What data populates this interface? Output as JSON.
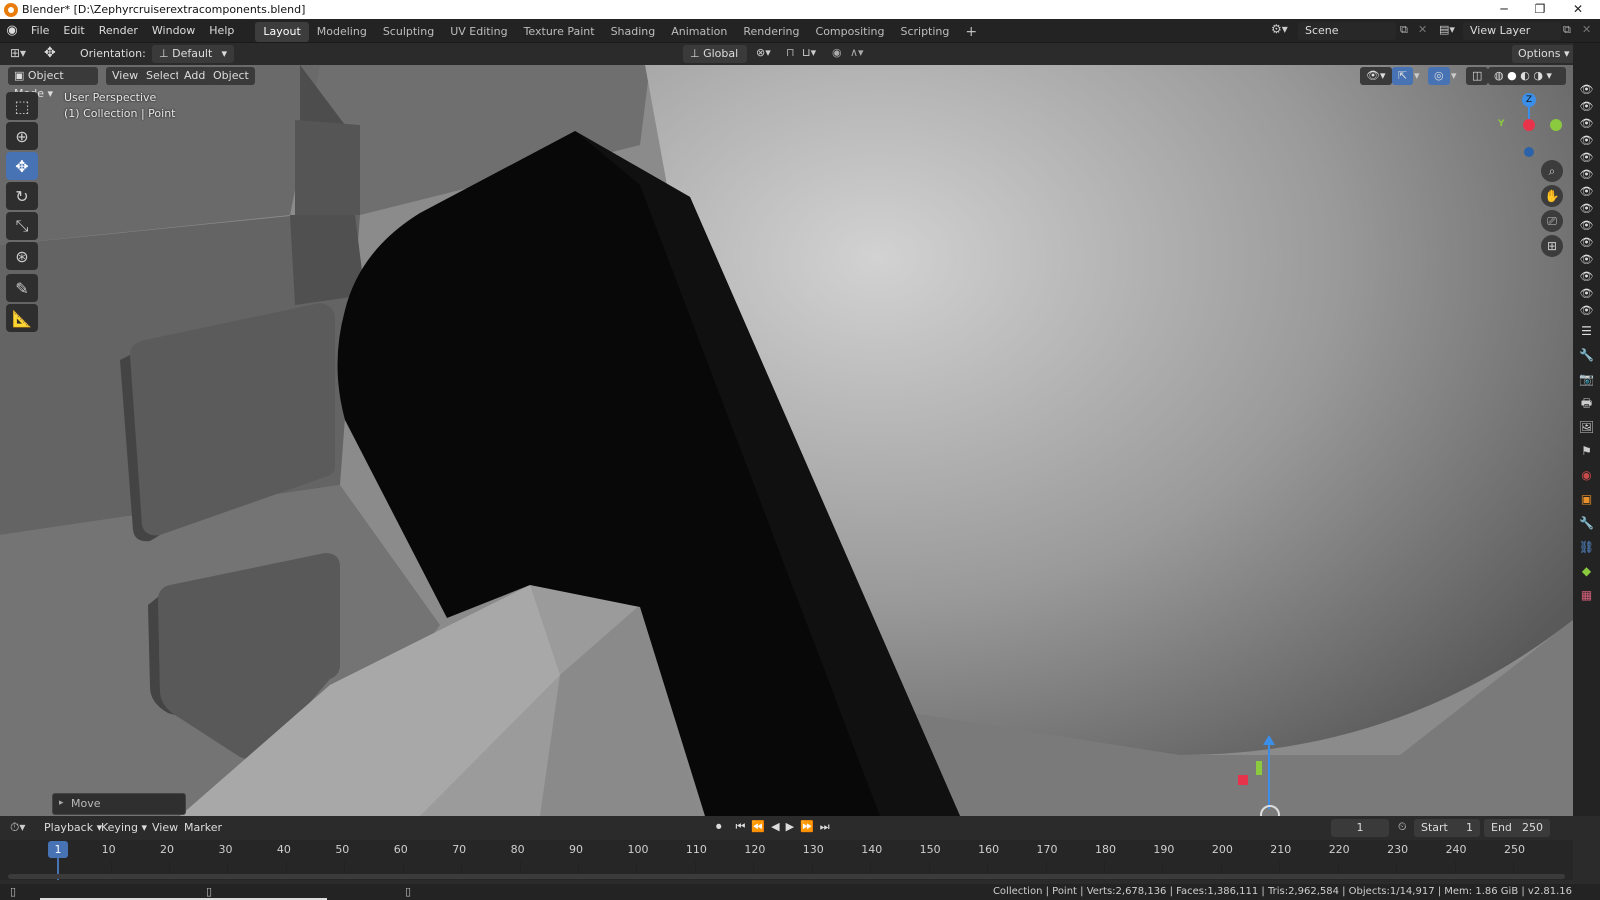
{
  "window": {
    "title": "Blender* [D:\\Zephyrcruiserextracomponents.blend]"
  },
  "menus": [
    "File",
    "Edit",
    "Render",
    "Window",
    "Help"
  ],
  "workspaces": [
    {
      "label": "Layout",
      "active": true
    },
    {
      "label": "Modeling"
    },
    {
      "label": "Sculpting"
    },
    {
      "label": "UV Editing"
    },
    {
      "label": "Texture Paint"
    },
    {
      "label": "Shading"
    },
    {
      "label": "Animation"
    },
    {
      "label": "Rendering"
    },
    {
      "label": "Compositing"
    },
    {
      "label": "Scripting"
    }
  ],
  "scene": {
    "name": "Scene",
    "view_layer": "View Layer"
  },
  "header": {
    "orientation_label": "Orientation:",
    "orientation_value": "Default",
    "transform_orientation": "Global",
    "options": "Options"
  },
  "viewport_header": {
    "mode": "Object Mode",
    "menus": [
      "View",
      "Select",
      "Add",
      "Object"
    ]
  },
  "viewport": {
    "perspective": "User Perspective",
    "collection_info": "(1) Collection | Point"
  },
  "gizmo": {
    "x": "X",
    "y": "Y",
    "z": "Z"
  },
  "last_op": "Move",
  "timeline": {
    "menus": [
      "Playback",
      "Keying",
      "View",
      "Marker"
    ],
    "current_frame": "1",
    "start_label": "Start",
    "start": "1",
    "end_label": "End",
    "end": "250",
    "ticks": [
      "1",
      "10",
      "20",
      "30",
      "40",
      "50",
      "60",
      "70",
      "80",
      "90",
      "100",
      "110",
      "120",
      "130",
      "140",
      "150",
      "160",
      "170",
      "180",
      "190",
      "200",
      "210",
      "220",
      "230",
      "240",
      "250"
    ]
  },
  "status": "Collection | Point | Verts:2,678,136 | Faces:1,386,111 | Tris:2,962,584 | Objects:1/14,917 | Mem: 1.86 GiB | v2.81.16",
  "colors": {
    "accent": "#4772b3",
    "x_axis": "#e8344a",
    "y_axis": "#8bc93f",
    "z_axis": "#3b8fe8"
  }
}
